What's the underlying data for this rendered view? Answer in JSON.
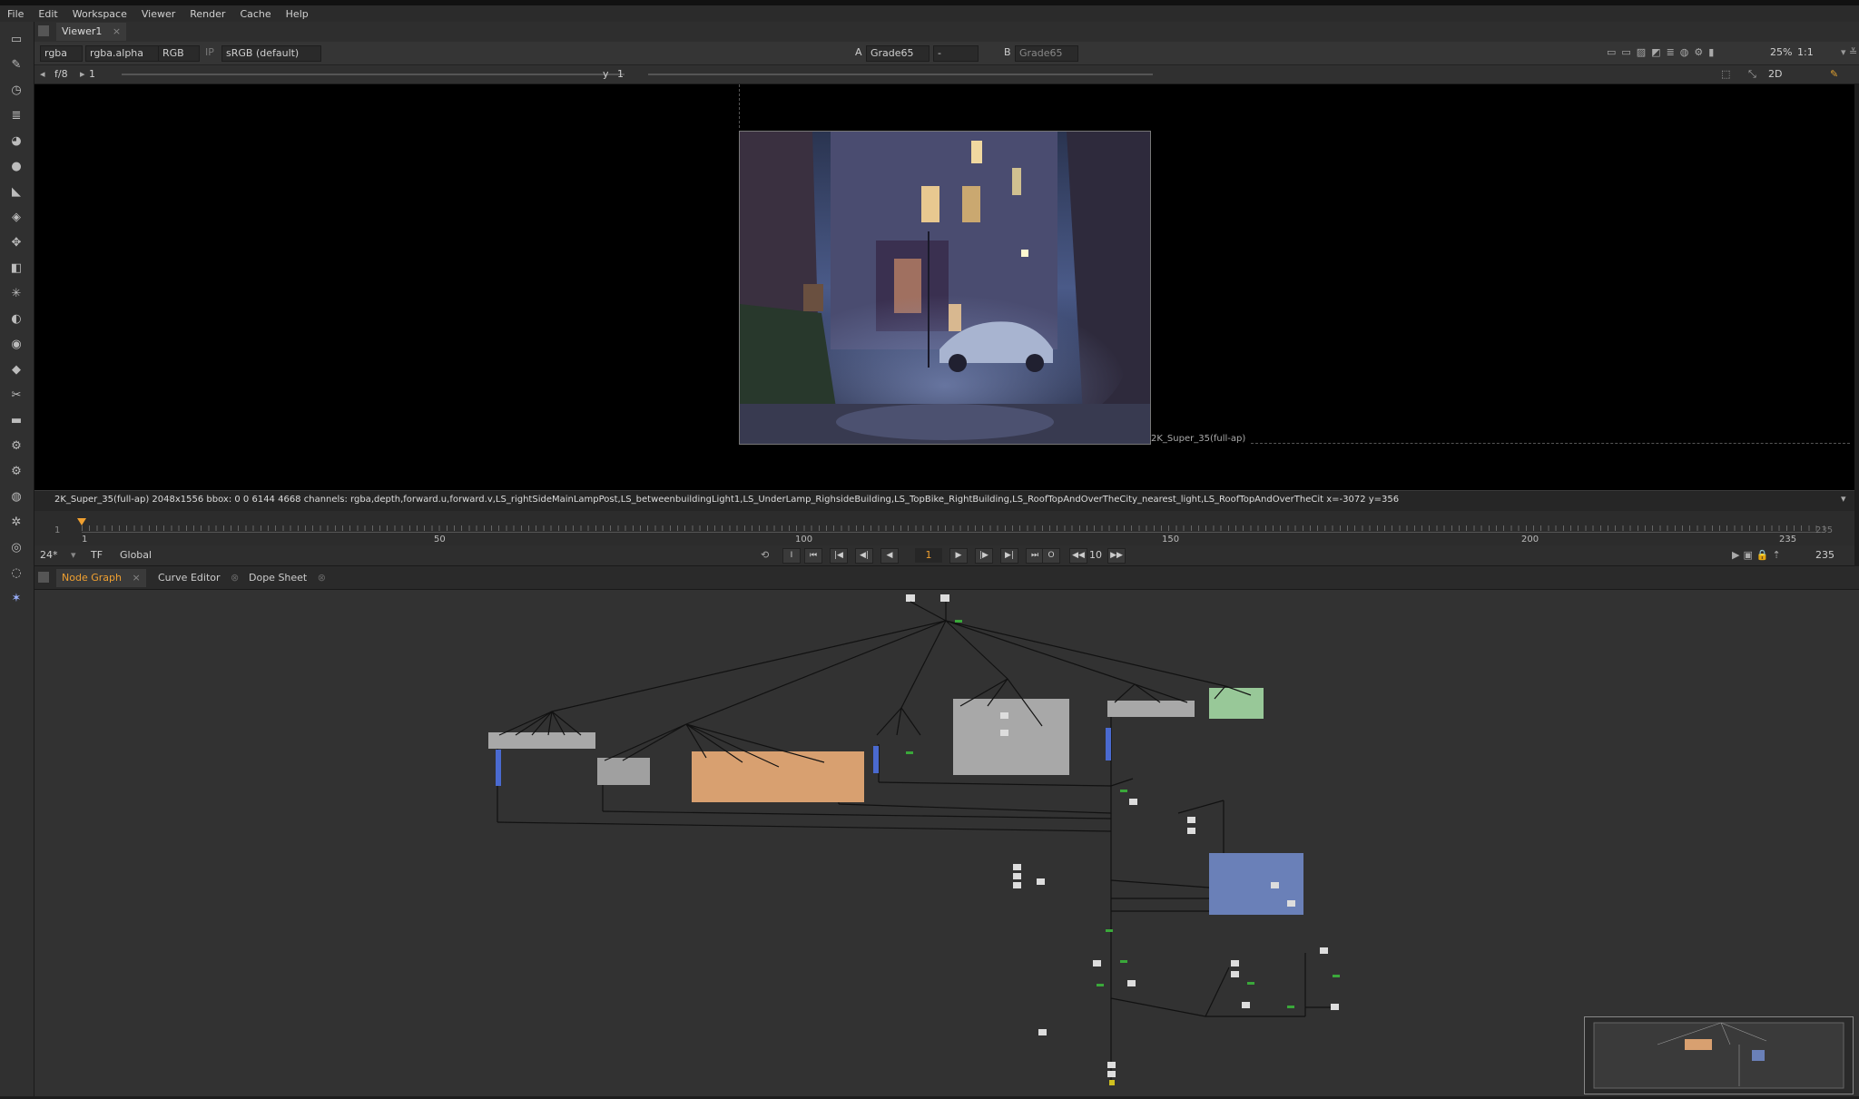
{
  "menu": [
    "File",
    "Edit",
    "Workspace",
    "Viewer",
    "Render",
    "Cache",
    "Help"
  ],
  "viewer_tab": {
    "label": "Viewer1",
    "close": "×"
  },
  "viewer_controls": {
    "channels": "rgba",
    "alpha": "rgba.alpha",
    "display": "RGB",
    "lut": "sRGB (default)",
    "input_a_label": "A",
    "input_a": "Grade65",
    "separator": "-",
    "input_b_label": "B",
    "input_b": "Grade65",
    "zoom": "25%",
    "ratio": "1:1",
    "view_mode": "2D"
  },
  "viewer_controls2": {
    "fstop": "f/8",
    "gain": "1",
    "gamma_label": "y",
    "gamma": "1"
  },
  "format_label": "2K_Super_35(full-ap)",
  "info_bar": "2K_Super_35(full-ap) 2048x1556  bbox: 0 0 6144 4668 channels: rgba,depth,forward.u,forward.v,LS_rightSideMainLampPost,LS_betweenbuildingLight1,LS_UnderLamp_RighsideBuilding,LS_TopBike_RightBuilding,LS_RoofTopAndOverTheCity_nearest_light,LS_RoofTopAndOverTheCit  x=-3072 y=356",
  "timeline": {
    "start": "1",
    "marks": [
      "1",
      "50",
      "100",
      "150",
      "200",
      "235"
    ],
    "end_label": "235",
    "current": 1,
    "total": 235
  },
  "playback": {
    "fps": "24*",
    "tf": "TF",
    "scope": "Global",
    "frame": "1",
    "increment": "10",
    "end_frame": "235"
  },
  "node_graph_tabs": [
    {
      "label": "Node Graph",
      "active": true
    },
    {
      "label": "Curve Editor",
      "active": false
    },
    {
      "label": "Dope Sheet",
      "active": false
    }
  ],
  "colors": {
    "accent": "#f0a030",
    "backdrop_grey": "#a0a0a0",
    "backdrop_orange": "#d8a070",
    "backdrop_green": "#90c090",
    "backdrop_blue": "#6a80b8"
  }
}
